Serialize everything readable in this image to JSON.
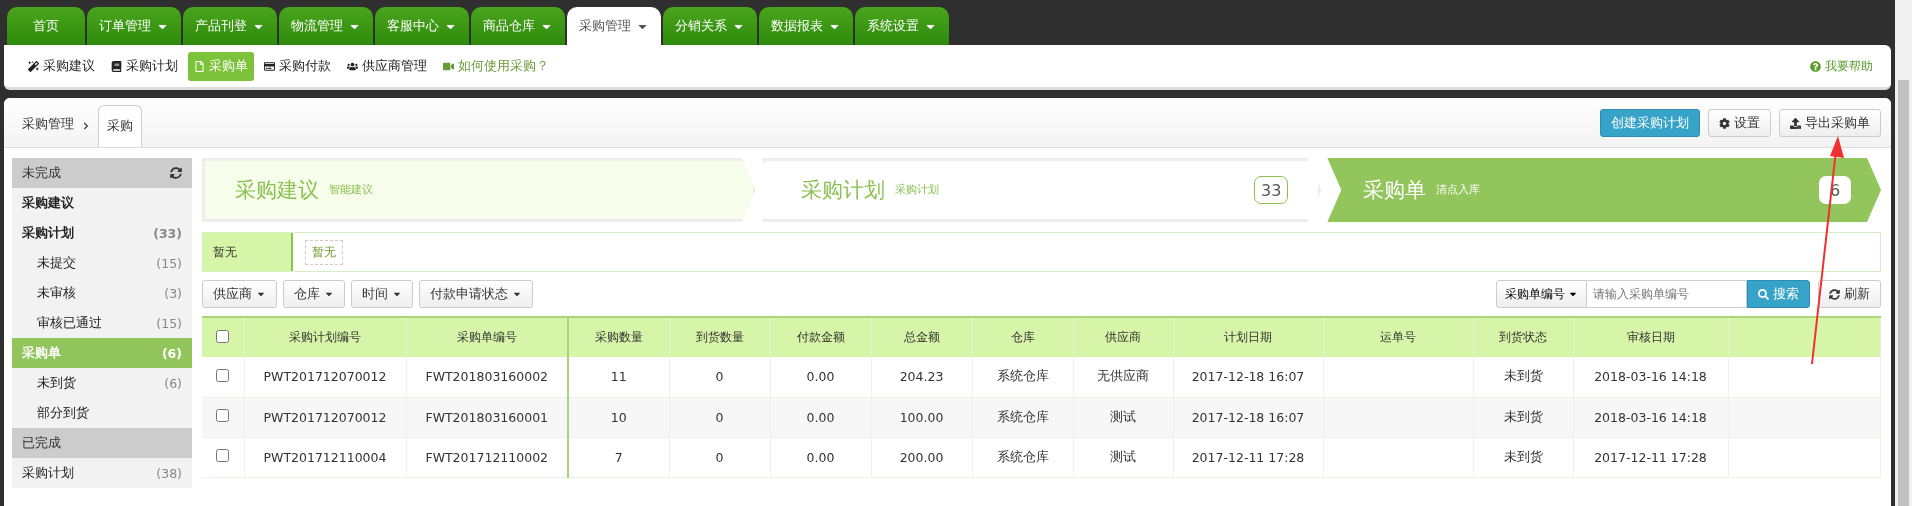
{
  "main_tabs": [
    {
      "label": "首页",
      "dropdown": false,
      "selected": false
    },
    {
      "label": "订单管理",
      "dropdown": true,
      "selected": false
    },
    {
      "label": "产品刊登",
      "dropdown": true,
      "selected": false
    },
    {
      "label": "物流管理",
      "dropdown": true,
      "selected": false
    },
    {
      "label": "客服中心",
      "dropdown": true,
      "selected": false
    },
    {
      "label": "商品仓库",
      "dropdown": true,
      "selected": false
    },
    {
      "label": "采购管理",
      "dropdown": true,
      "selected": true
    },
    {
      "label": "分销关系",
      "dropdown": true,
      "selected": false
    },
    {
      "label": "数据报表",
      "dropdown": true,
      "selected": false
    },
    {
      "label": "系统设置",
      "dropdown": true,
      "selected": false
    }
  ],
  "sub_nav": [
    {
      "label": "采购建议",
      "selected": false,
      "kind": "link"
    },
    {
      "label": "采购计划",
      "selected": false,
      "kind": "link"
    },
    {
      "label": "采购单",
      "selected": true,
      "kind": "link"
    },
    {
      "label": "采购付款",
      "selected": false,
      "kind": "link"
    },
    {
      "label": "供应商管理",
      "selected": false,
      "kind": "link"
    },
    {
      "label": "如何使用采购？",
      "selected": false,
      "kind": "help"
    }
  ],
  "help_link": "我要帮助",
  "breadcrumb": {
    "parent": "采购管理",
    "current": "采购"
  },
  "actions": [
    {
      "label": "创建采购计划",
      "kind": "primary"
    },
    {
      "label": "设置",
      "kind": "settings"
    },
    {
      "label": "导出采购单",
      "kind": "export"
    }
  ],
  "sidebar": [
    {
      "title": "未完成",
      "items": [
        {
          "label": "采购建议",
          "bold": true,
          "selected": false
        },
        {
          "label": "采购计划",
          "count": "(33)",
          "bold": true,
          "selected": false,
          "children": [
            {
              "label": "未提交",
              "count": "(15)"
            },
            {
              "label": "未审核",
              "count": "(3)"
            },
            {
              "label": "审核已通过",
              "count": "(15)"
            }
          ]
        },
        {
          "label": "采购单",
          "count": "(6)",
          "bold": true,
          "selected": true,
          "children": [
            {
              "label": "未到货",
              "count": "(6)"
            },
            {
              "label": "部分到货"
            }
          ]
        }
      ]
    },
    {
      "title": "已完成",
      "items": [
        {
          "label": "采购计划",
          "count": "(38)",
          "bold": false,
          "selected": false
        }
      ]
    }
  ],
  "steps": [
    {
      "title": "采购建议",
      "subtitle": "智能建议",
      "selected": false
    },
    {
      "title": "采购计划",
      "subtitle": "采购计划",
      "count": "33",
      "selected": false
    },
    {
      "title": "采购单",
      "subtitle": "清点入库",
      "count": "6",
      "selected": true
    }
  ],
  "status_bar": {
    "label": "暂无",
    "tag": "暂无"
  },
  "filters": [
    "供应商",
    "仓库",
    "时间",
    "付款申请状态"
  ],
  "search": {
    "type": "采购单编号",
    "placeholder": "请输入采购单编号",
    "button": "搜索"
  },
  "refresh": "刷新",
  "table": {
    "all_checked": false,
    "columns": [
      "采购计划编号",
      "采购单编号",
      "采购数量",
      "到货数量",
      "付款金额",
      "总金额",
      "仓库",
      "供应商",
      "计划日期",
      "运单号",
      "到货状态",
      "审核日期"
    ],
    "rows": [
      {
        "checked": false,
        "cells": [
          "PWT201712070012",
          "FWT201803160002",
          "11",
          "0",
          "0.00",
          "204.23",
          "系统仓库",
          "无供应商",
          "2017-12-18 16:07",
          "",
          "未到货",
          "2018-03-16 14:18"
        ]
      },
      {
        "checked": false,
        "cells": [
          "PWT201712070012",
          "FWT201803160001",
          "10",
          "0",
          "0.00",
          "100.00",
          "系统仓库",
          "测试",
          "2017-12-18 16:07",
          "",
          "未到货",
          "2018-03-16 14:18"
        ]
      },
      {
        "checked": false,
        "cells": [
          "PWT201712110004",
          "FWT201712110002",
          "7",
          "0",
          "0.00",
          "200.00",
          "系统仓库",
          "测试",
          "2017-12-11 17:28",
          "",
          "未到货",
          "2017-12-11 17:28"
        ]
      }
    ]
  }
}
